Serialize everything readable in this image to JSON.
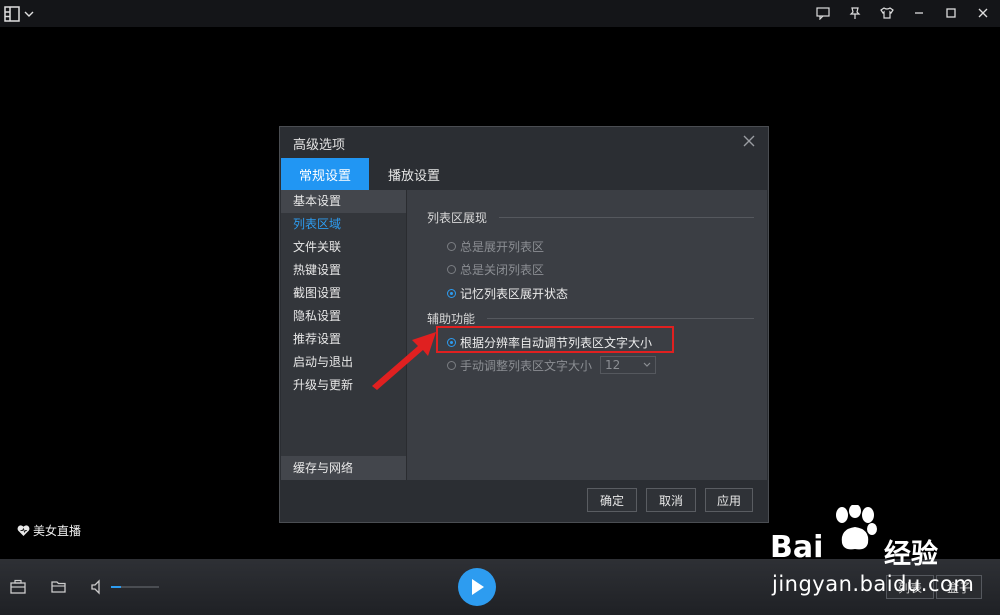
{
  "dialog": {
    "title": "高级选项",
    "tabs": [
      {
        "label": "常规设置"
      },
      {
        "label": "播放设置"
      }
    ],
    "nav": [
      {
        "label": "基本设置"
      },
      {
        "label": "列表区域"
      },
      {
        "label": "文件关联"
      },
      {
        "label": "热键设置"
      },
      {
        "label": "截图设置"
      },
      {
        "label": "隐私设置"
      },
      {
        "label": "推荐设置"
      },
      {
        "label": "启动与退出"
      },
      {
        "label": "升级与更新"
      }
    ],
    "nav_bottom": "缓存与网络",
    "section_list": {
      "title": "列表区展现",
      "options": [
        {
          "label": "总是展开列表区",
          "checked": false,
          "enabled": false
        },
        {
          "label": "总是关闭列表区",
          "checked": false,
          "enabled": false
        },
        {
          "label": "记忆列表区展开状态",
          "checked": true,
          "enabled": true
        }
      ]
    },
    "section_aux": {
      "title": "辅助功能",
      "option_auto": {
        "label": "根据分辨率自动调节列表区文字大小",
        "checked": true
      },
      "option_manual": {
        "label": "手动调整列表区文字大小",
        "checked": false
      },
      "font_size_value": "12"
    },
    "buttons": {
      "ok": "确定",
      "cancel": "取消",
      "apply": "应用"
    }
  },
  "live_tag": "美女直播",
  "bottom": {
    "list_label": "列表",
    "box_label": "盒子",
    "volume_level": 0.2
  },
  "watermark": {
    "brand": "Bai",
    "brand_cn": "经验",
    "url": "jingyan.baidu.com"
  },
  "colors": {
    "accent": "#2196f3",
    "highlight_red": "#e02020"
  },
  "icons": {
    "menu": "app-menu-icon",
    "feedback": "feedback-icon",
    "pin": "pin-icon",
    "skin": "shirt-icon",
    "minimize": "minimize-icon",
    "maximize": "maximize-icon",
    "close": "close-icon"
  }
}
